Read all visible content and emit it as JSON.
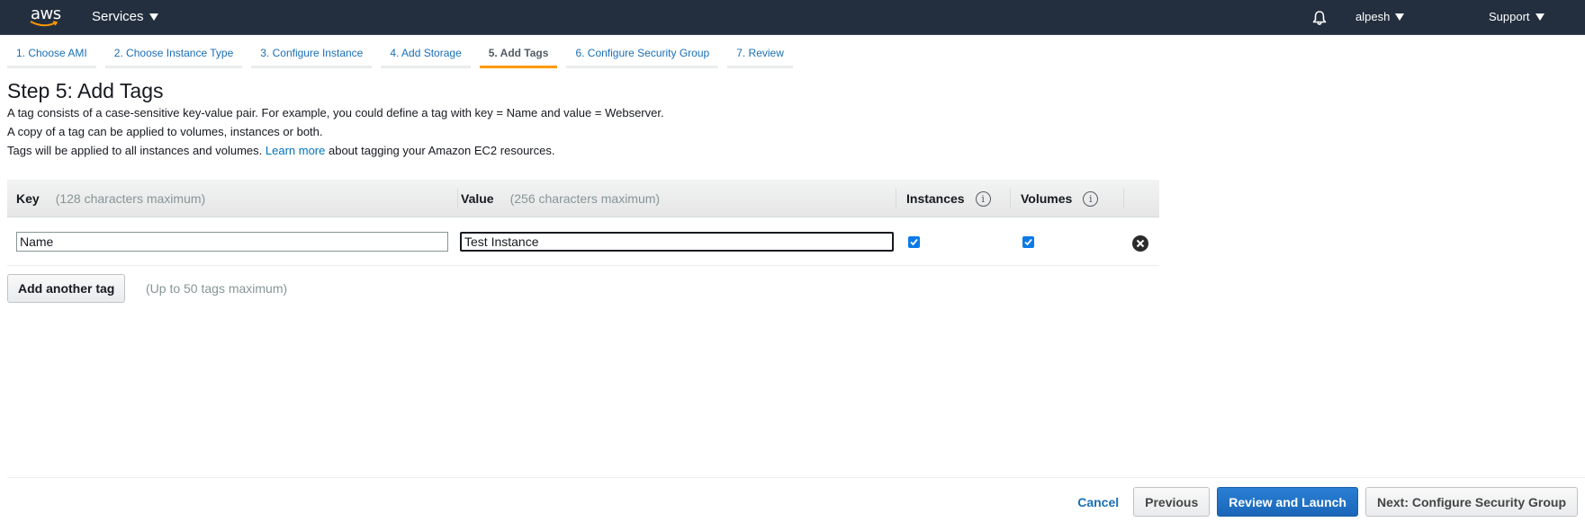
{
  "nav": {
    "logo_text": "aws",
    "services_label": "Services",
    "user_label": "alpesh",
    "support_label": "Support",
    "colors": {
      "background": "#232f3e",
      "logo_smile": "#ff9900"
    }
  },
  "wizard": {
    "tabs": [
      {
        "label": "1. Choose AMI",
        "active": false
      },
      {
        "label": "2. Choose Instance Type",
        "active": false
      },
      {
        "label": "3. Configure Instance",
        "active": false
      },
      {
        "label": "4. Add Storage",
        "active": false
      },
      {
        "label": "5. Add Tags",
        "active": true
      },
      {
        "label": "6. Configure Security Group",
        "active": false
      },
      {
        "label": "7. Review",
        "active": false
      }
    ],
    "active_color": "#ff9900"
  },
  "page": {
    "title": "Step 5: Add Tags",
    "desc_line1": "A tag consists of a case-sensitive key-value pair. For example, you could define a tag with key = Name and value = Webserver.",
    "desc_line2": "A copy of a tag can be applied to volumes, instances or both.",
    "desc_line3_before": "Tags will be applied to all instances and volumes. ",
    "desc_line3_link": "Learn more",
    "desc_line3_after": " about tagging your Amazon EC2 resources."
  },
  "table": {
    "headers": {
      "key": "Key",
      "key_hint": "(128 characters maximum)",
      "value": "Value",
      "value_hint": "(256 characters maximum)",
      "instances": "Instances",
      "volumes": "Volumes",
      "info_glyph": "i"
    },
    "rows": [
      {
        "key": "Name",
        "value": "Test Instance",
        "instances": true,
        "volumes": true
      }
    ]
  },
  "add_tag": {
    "button_label": "Add another tag",
    "hint": "(Up to 50 tags maximum)"
  },
  "footer": {
    "cancel": "Cancel",
    "previous": "Previous",
    "review_launch": "Review and Launch",
    "next": "Next: Configure Security Group",
    "primary_color": "#1a66b8"
  }
}
